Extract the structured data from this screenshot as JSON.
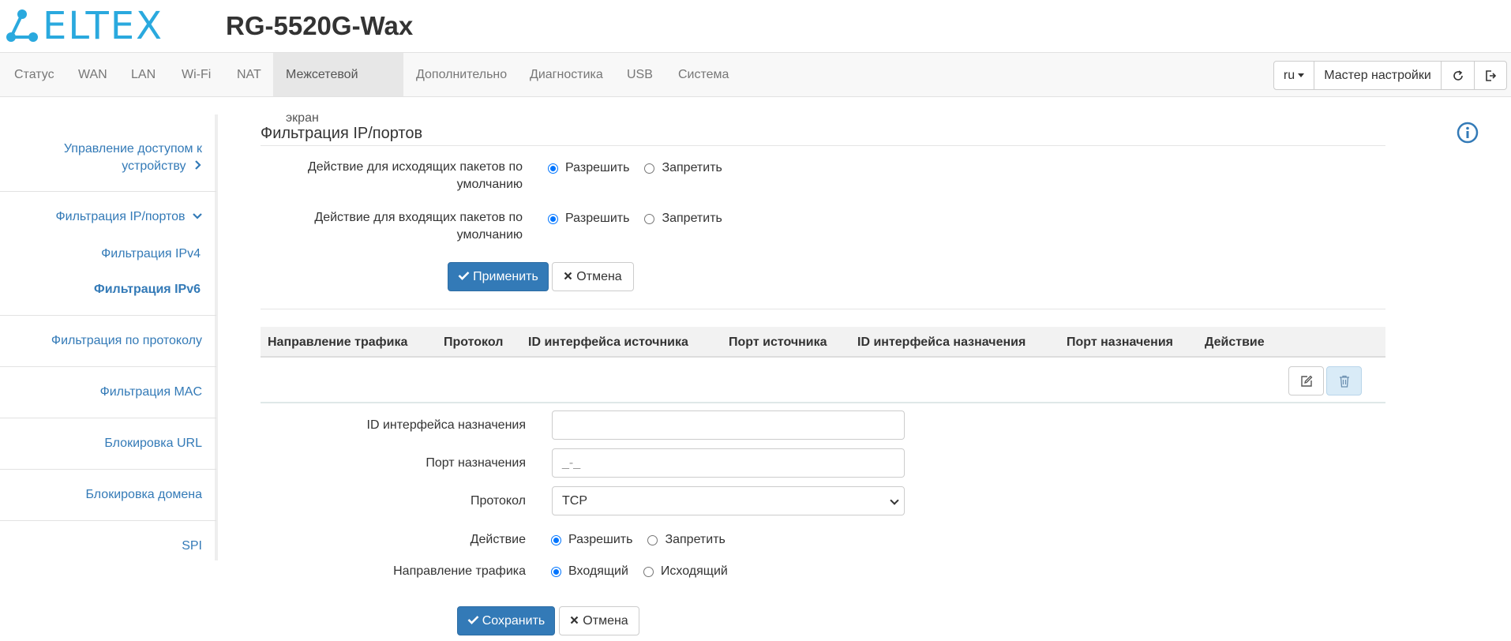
{
  "header": {
    "logo_text": "ELTEX",
    "model": "RG-5520G-Wax"
  },
  "nav": {
    "items": [
      "Статус",
      "WAN",
      "LAN",
      "Wi-Fi",
      "NAT",
      "Межсетевой экран",
      "Дополнительно",
      "Диагностика",
      "USB",
      "Система"
    ],
    "active": "Межсетевой экран",
    "lang": "ru",
    "wizard": "Мастер настройки",
    "refresh_icon": "refresh-icon",
    "logout_icon": "logout-icon"
  },
  "sidebar": {
    "items": [
      {
        "label": "Управление доступом к устройству",
        "line1": "Управление доступом к",
        "line2": "устройству",
        "icon": "chevron-right-icon"
      },
      {
        "label": "Фильтрация IP/портов",
        "icon": "chevron-down-icon"
      },
      {
        "label": "Фильтрация IPv4"
      },
      {
        "label": "Фильтрация IPv6",
        "active": true
      },
      {
        "label": "Фильтрация по протоколу"
      },
      {
        "label": "Фильтрация MAC"
      },
      {
        "label": "Блокировка URL"
      },
      {
        "label": "Блокировка домена"
      },
      {
        "label": "SPI"
      }
    ]
  },
  "main": {
    "title": "Фильтрация IP/портов",
    "outgoing": {
      "label1": "Действие для исходящих пакетов по",
      "label2": "умолчанию",
      "options": [
        "Разрешить",
        "Запретить"
      ],
      "selected": "Разрешить"
    },
    "incoming": {
      "label1": "Действие для входящих пакетов по",
      "label2": "умолчанию",
      "options": [
        "Разрешить",
        "Запретить"
      ],
      "selected": "Разрешить"
    },
    "apply": "Применить",
    "cancel": "Отмена",
    "table": {
      "columns": [
        "Направление трафика",
        "Протокол",
        "ID интерфейса источника",
        "Порт источника",
        "ID интерфейса назначения",
        "Порт назначения",
        "Действие"
      ],
      "edit_icon": "edit-icon",
      "delete_icon": "trash-icon"
    },
    "form": {
      "dst_iface_label": "ID интерфейса назначения",
      "dst_iface_value": "",
      "dst_port_label": "Порт назначения",
      "dst_port_placeholder": "_-_",
      "protocol_label": "Протокол",
      "protocol_value": "TCP",
      "action_label": "Действие",
      "action_options": [
        "Разрешить",
        "Запретить"
      ],
      "action_selected": "Разрешить",
      "direction_label": "Направление трафика",
      "direction_options": [
        "Входящий",
        "Исходящий"
      ],
      "direction_selected": "Входящий",
      "save": "Сохранить",
      "cancel": "Отмена"
    },
    "info_icon": "info-icon"
  },
  "colors": {
    "brand": "#2aa9de",
    "primary": "#337ab7",
    "link": "#337ab7"
  }
}
